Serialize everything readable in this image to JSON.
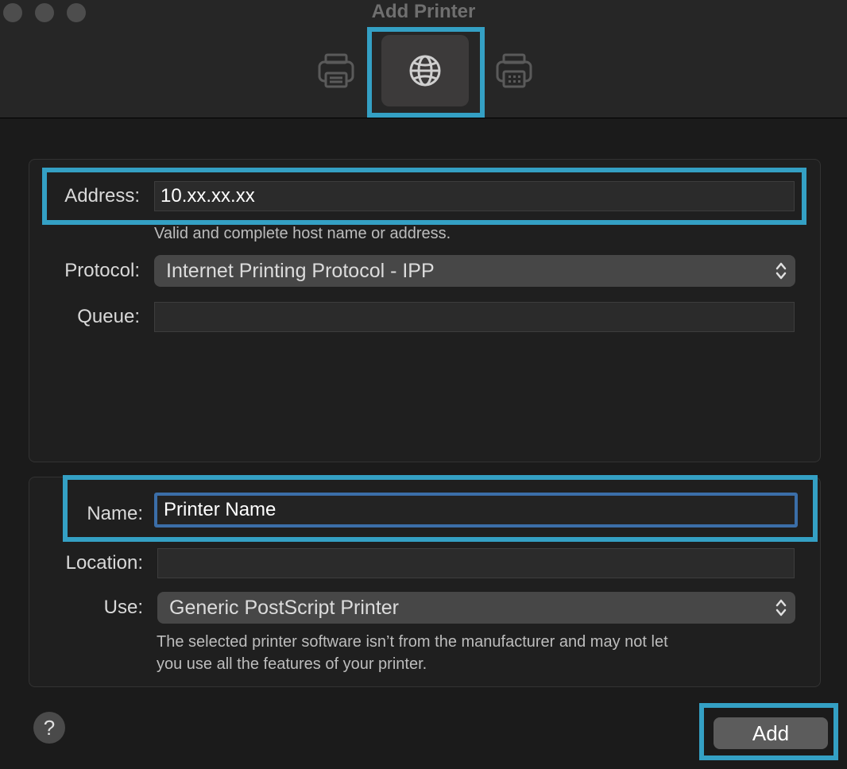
{
  "window": {
    "title": "Add Printer"
  },
  "toolbar": {
    "items": [
      {
        "icon": "printer-icon",
        "selected": false
      },
      {
        "icon": "globe-icon",
        "selected": true
      },
      {
        "icon": "printer-fax-icon",
        "selected": false
      }
    ]
  },
  "connection": {
    "address_label": "Address:",
    "address_value": "10.xx.xx.xx",
    "address_hint": "Valid and complete host name or address.",
    "protocol_label": "Protocol:",
    "protocol_value": "Internet Printing Protocol - IPP",
    "queue_label": "Queue:",
    "queue_value": ""
  },
  "details": {
    "name_label": "Name:",
    "name_value": "Printer Name",
    "location_label": "Location:",
    "location_value": "",
    "use_label": "Use:",
    "use_value": "Generic PostScript Printer",
    "use_hint_line1": "The selected printer software isn’t from the manufacturer and may not let",
    "use_hint_line2": "you use all the features of your printer."
  },
  "footer": {
    "help_label": "?",
    "add_label": "Add"
  },
  "colors": {
    "highlight": "#34a0c4",
    "focus_ring": "#3b6ea8",
    "background": "#1b1b1b"
  }
}
